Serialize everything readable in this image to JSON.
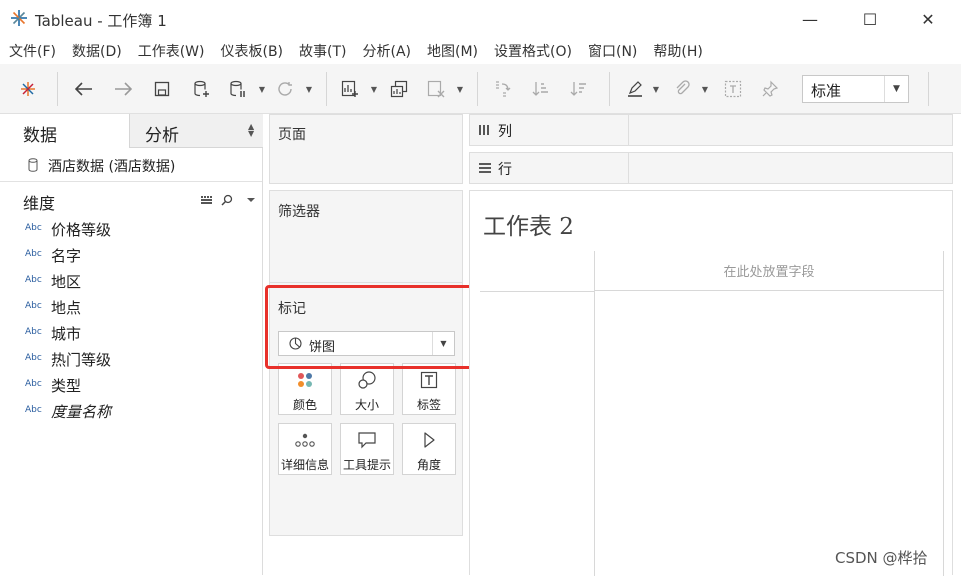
{
  "window": {
    "title": "Tableau - 工作簿 1",
    "controls": {
      "minimize": "—",
      "maximize": "☐",
      "close": "✕"
    }
  },
  "menu": [
    "文件(F)",
    "数据(D)",
    "工作表(W)",
    "仪表板(B)",
    "故事(T)",
    "分析(A)",
    "地图(M)",
    "设置格式(O)",
    "窗口(N)",
    "帮助(H)"
  ],
  "toolbar": {
    "icons": [
      "tableau-logo-icon",
      "back-icon",
      "forward-icon",
      "save-icon",
      "new-datasource-icon",
      "pause-updates-icon",
      "refresh-icon",
      "new-worksheet-icon",
      "duplicate-icon",
      "clear-sheet-icon",
      "swap-icon",
      "sort-asc-icon",
      "sort-desc-icon",
      "highlight-icon",
      "group-icon",
      "show-labels-icon",
      "pin-icon"
    ],
    "view_mode": "标准"
  },
  "left_pane": {
    "tabs": {
      "data": "数据",
      "analysis": "分析"
    },
    "datasource": "酒店数据 (酒店数据)",
    "dimensions_title": "维度",
    "fields": [
      {
        "type": "Abc",
        "name": "价格等级",
        "italic": false
      },
      {
        "type": "Abc",
        "name": "名字",
        "italic": false
      },
      {
        "type": "Abc",
        "name": "地区",
        "italic": false
      },
      {
        "type": "Abc",
        "name": "地点",
        "italic": false
      },
      {
        "type": "Abc",
        "name": "城市",
        "italic": false
      },
      {
        "type": "Abc",
        "name": "热门等级",
        "italic": false
      },
      {
        "type": "Abc",
        "name": "类型",
        "italic": false
      },
      {
        "type": "Abc",
        "name": "度量名称",
        "italic": true
      }
    ]
  },
  "cards": {
    "pages": "页面",
    "filters": "筛选器",
    "marks": {
      "title": "标记",
      "mark_type": "饼图",
      "buttons": [
        {
          "label": "颜色",
          "icon": "color-dots-icon"
        },
        {
          "label": "大小",
          "icon": "size-circles-icon"
        },
        {
          "label": "标签",
          "icon": "label-T-icon"
        },
        {
          "label": "详细信息",
          "icon": "detail-dots-icon"
        },
        {
          "label": "工具提示",
          "icon": "tooltip-bubble-icon"
        },
        {
          "label": "角度",
          "icon": "angle-icon"
        }
      ]
    }
  },
  "shelves": {
    "columns": "列",
    "rows": "行"
  },
  "view": {
    "sheet_title": "工作表 2",
    "drop_field_hint": "在此处放置字段"
  },
  "watermark": "CSDN @桦拾",
  "colors": {
    "highlight": "#e8302a",
    "abc": "#2a5d9f",
    "tab_active_bg": "#ffffff",
    "panel_bg": "#f5f5f5"
  }
}
